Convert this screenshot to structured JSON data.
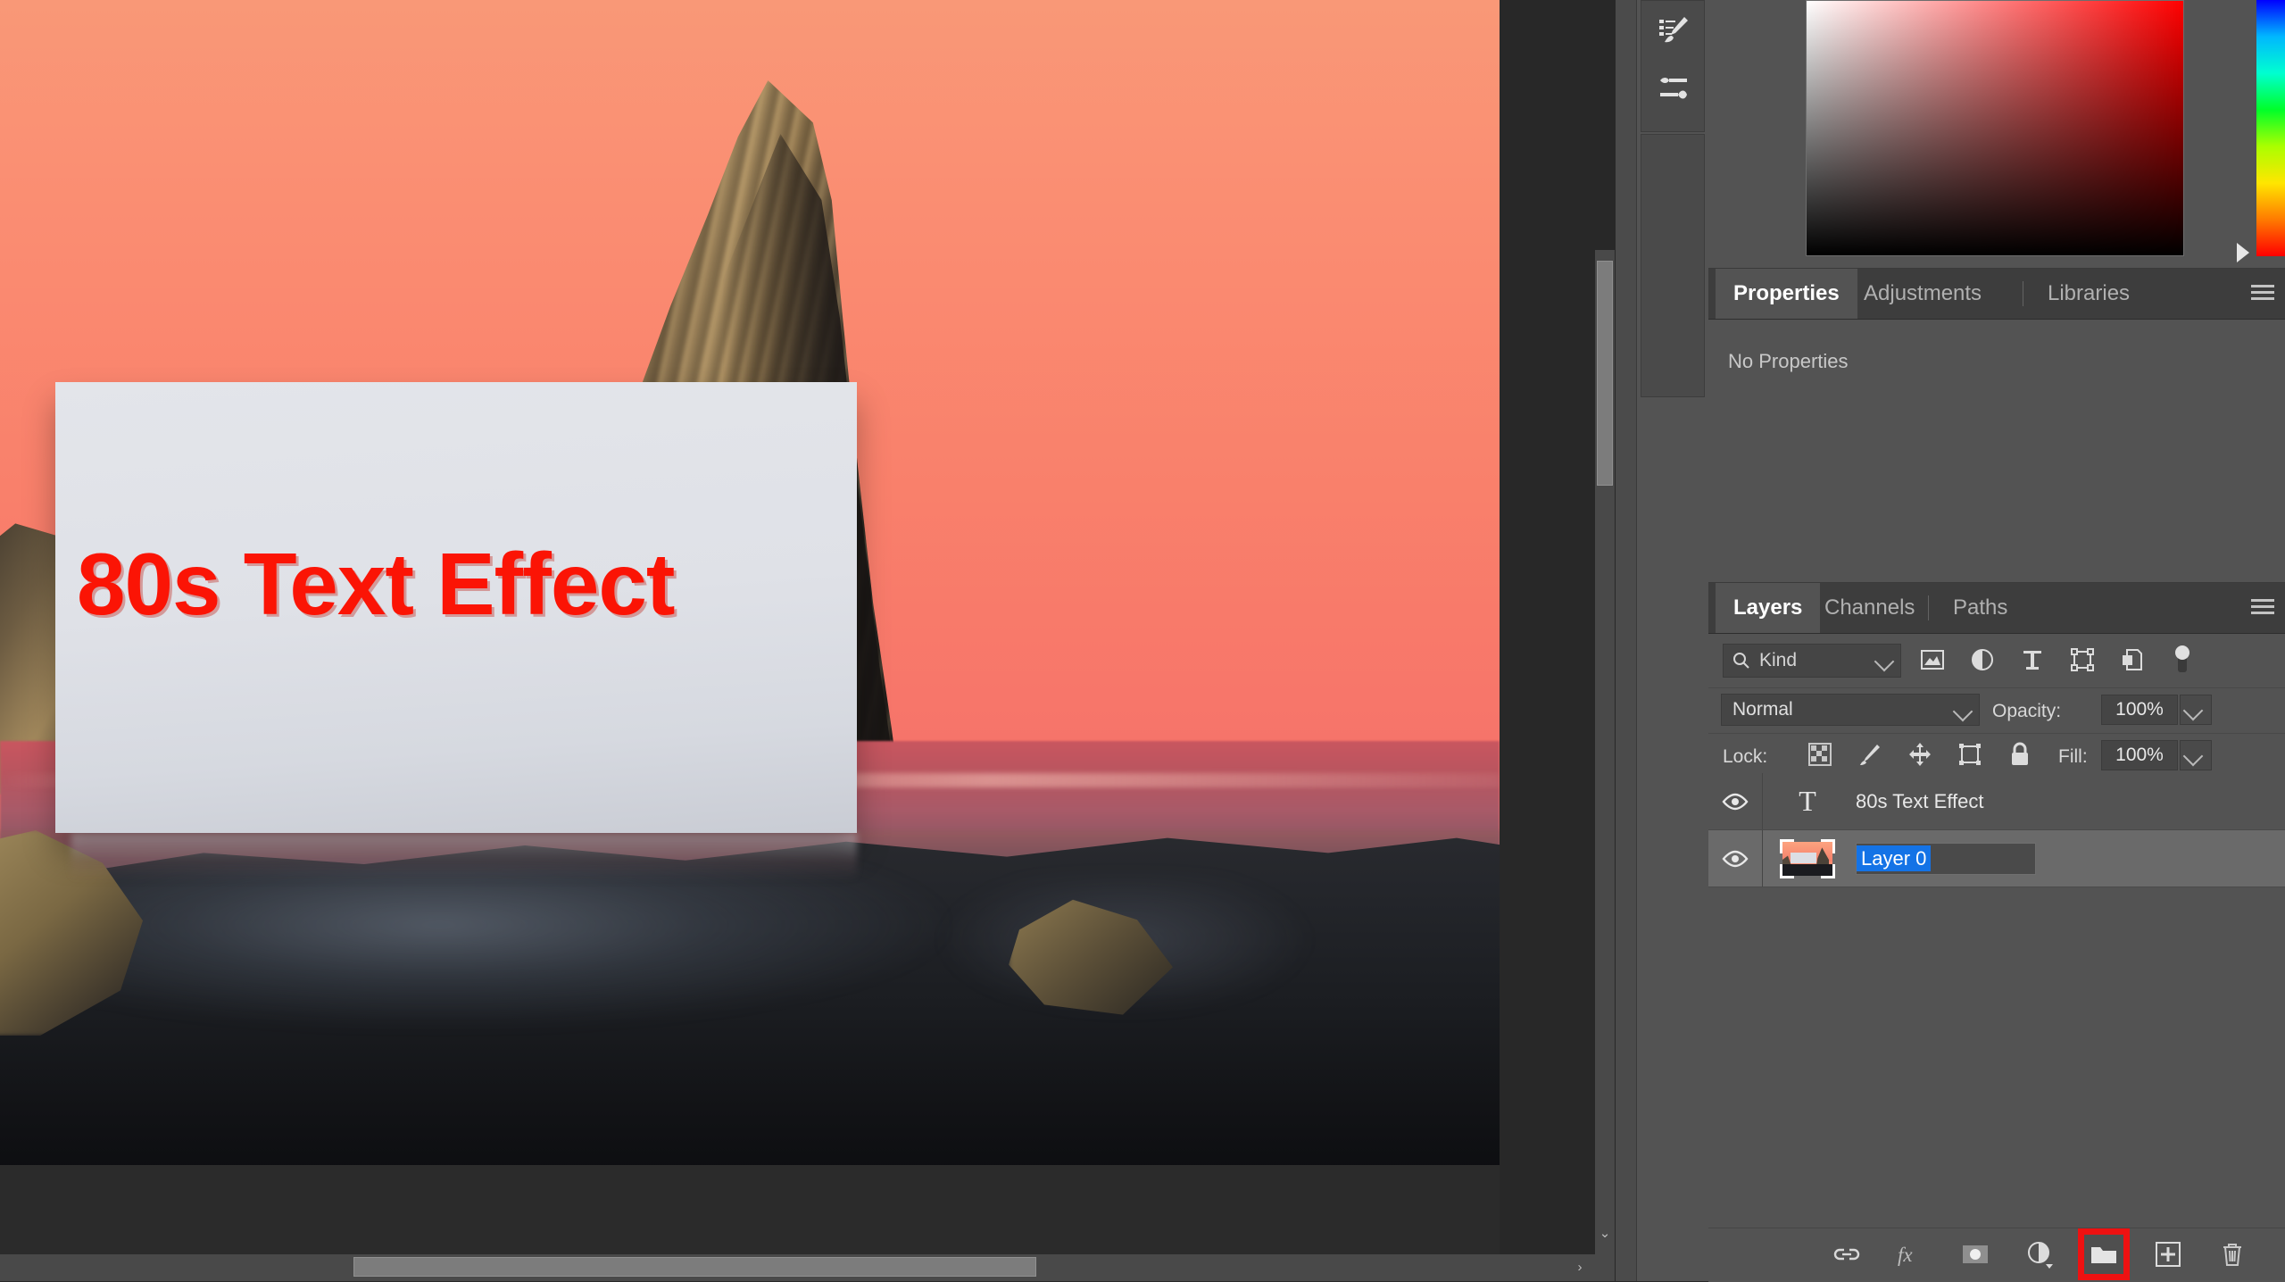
{
  "canvas": {
    "card_text": "80s Text Effect",
    "text_color": "#fb1405",
    "sky_color": "#f8866f",
    "card_color": "#dfe1e7"
  },
  "icon_dock": {
    "items": [
      {
        "name": "brush-settings-icon",
        "label": "Brush Settings"
      },
      {
        "name": "brush-presets-icon",
        "label": "Brushes"
      }
    ]
  },
  "color_picker": {
    "name": "Color",
    "hue": "#ff0000",
    "hue_stops": [
      "#0000ff",
      "#00b7ff",
      "#00ffd0",
      "#00ff2a",
      "#aaff00",
      "#ffe600",
      "#ff7a00",
      "#ff0000"
    ]
  },
  "properties_panel": {
    "tabs": [
      {
        "label": "Properties",
        "active": true
      },
      {
        "label": "Adjustments",
        "active": false
      },
      {
        "label": "Libraries",
        "active": false
      }
    ],
    "body_text": "No Properties",
    "menu_label": "Panel menu"
  },
  "layers_panel": {
    "tabs": [
      {
        "label": "Layers",
        "active": true
      },
      {
        "label": "Channels",
        "active": false
      },
      {
        "label": "Paths",
        "active": false
      }
    ],
    "menu_label": "Panel menu",
    "filter": {
      "kind_label": "Kind",
      "search_icon": "search-icon",
      "icons": [
        {
          "name": "filter-pixel-icon",
          "label": "Pixel layers"
        },
        {
          "name": "filter-adjustment-icon",
          "label": "Adjustment layers"
        },
        {
          "name": "filter-type-icon",
          "label": "Type layers"
        },
        {
          "name": "filter-shape-icon",
          "label": "Shape layers"
        },
        {
          "name": "filter-smart-object-icon",
          "label": "Smart objects"
        }
      ],
      "toggle_name": "filter-toggle-switch"
    },
    "blend": {
      "mode": "Normal",
      "opacity_label": "Opacity:",
      "opacity_value": "100%"
    },
    "lock": {
      "label": "Lock:",
      "fill_label": "Fill:",
      "fill_value": "100%",
      "icons": [
        {
          "name": "lock-transparent-pixels-icon",
          "label": "Lock transparent pixels"
        },
        {
          "name": "lock-image-pixels-icon",
          "label": "Lock image pixels"
        },
        {
          "name": "lock-position-icon",
          "label": "Lock position"
        },
        {
          "name": "lock-artboard-nesting-icon",
          "label": "Prevent auto-nesting"
        },
        {
          "name": "lock-all-icon",
          "label": "Lock all"
        }
      ]
    },
    "layers": [
      {
        "name": "80s Text Effect",
        "kind": "type",
        "visible": true,
        "selected": false,
        "editing": false
      },
      {
        "name": "Layer 0",
        "kind": "image",
        "visible": true,
        "selected": true,
        "editing": true
      }
    ],
    "footer_icons": [
      {
        "name": "link-layers-icon",
        "label": "Link layers",
        "highlight": false
      },
      {
        "name": "layer-style-fx-icon",
        "label": "Add a layer style",
        "highlight": false
      },
      {
        "name": "add-layer-mask-icon",
        "label": "Add layer mask",
        "highlight": false
      },
      {
        "name": "new-adjustment-layer-icon",
        "label": "Create new fill or adjustment layer",
        "highlight": false
      },
      {
        "name": "new-group-icon",
        "label": "Create a new group",
        "highlight": true
      },
      {
        "name": "new-layer-icon",
        "label": "Create a new layer",
        "highlight": false
      },
      {
        "name": "delete-layer-icon",
        "label": "Delete layer",
        "highlight": false
      }
    ],
    "highlight_color": "#ee1111"
  },
  "scrollbars": {
    "vertical_chevron": "⌄",
    "horizontal_chevron": "›"
  }
}
